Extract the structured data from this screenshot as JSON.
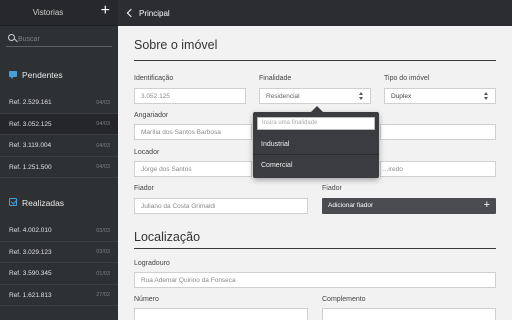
{
  "sidebar": {
    "title": "Vistorias",
    "add_label": "+",
    "search_placeholder": "Buscar",
    "pending_label": "Pendentes",
    "done_label": "Realizadas",
    "pending": [
      {
        "ref": "Ref. 2.529.161",
        "date": "04/03"
      },
      {
        "ref": "Ref. 3.052.125",
        "date": "04/03"
      },
      {
        "ref": "Ref. 3.119.004",
        "date": "04/03"
      },
      {
        "ref": "Ref. 1.251.500",
        "date": "04/03"
      }
    ],
    "done": [
      {
        "ref": "Ref. 4.002.010",
        "date": "03/03"
      },
      {
        "ref": "Ref. 3.029.123",
        "date": "03/03"
      },
      {
        "ref": "Ref. 3.590.345",
        "date": "01/03"
      },
      {
        "ref": "Ref. 1.621.813",
        "date": "27/02"
      }
    ]
  },
  "header": {
    "back_label": "Principal"
  },
  "form": {
    "section1_title": "Sobre o imóvel",
    "identificacao": {
      "label": "Identificação",
      "value": "3.052.125"
    },
    "finalidade": {
      "label": "Finalidade",
      "value": "Residencial"
    },
    "tipo": {
      "label": "Tipo do imóvel",
      "value": "Duplex"
    },
    "angariador": {
      "label": "Angariador",
      "value": "Marília dos Santos Barbosa"
    },
    "locador": {
      "label": "Locador",
      "value": "Jorge dos Santos"
    },
    "locador2": {
      "value": "...iredo"
    },
    "fiador1": {
      "label": "Fiador",
      "value": "Juliano da Costa Grimaldi"
    },
    "fiador2": {
      "label": "Fiador",
      "button": "Adicionar fiador",
      "plus": "+"
    },
    "section2_title": "Localização",
    "logradouro": {
      "label": "Logradouro",
      "value": "Rua Ademar Quirino da Fonseca"
    },
    "numero": {
      "label": "Número"
    },
    "complemento": {
      "label": "Complemento"
    }
  },
  "dropdown": {
    "placeholder": "Insira uma finalidade",
    "options": [
      "Industrial",
      "Comercial"
    ]
  }
}
